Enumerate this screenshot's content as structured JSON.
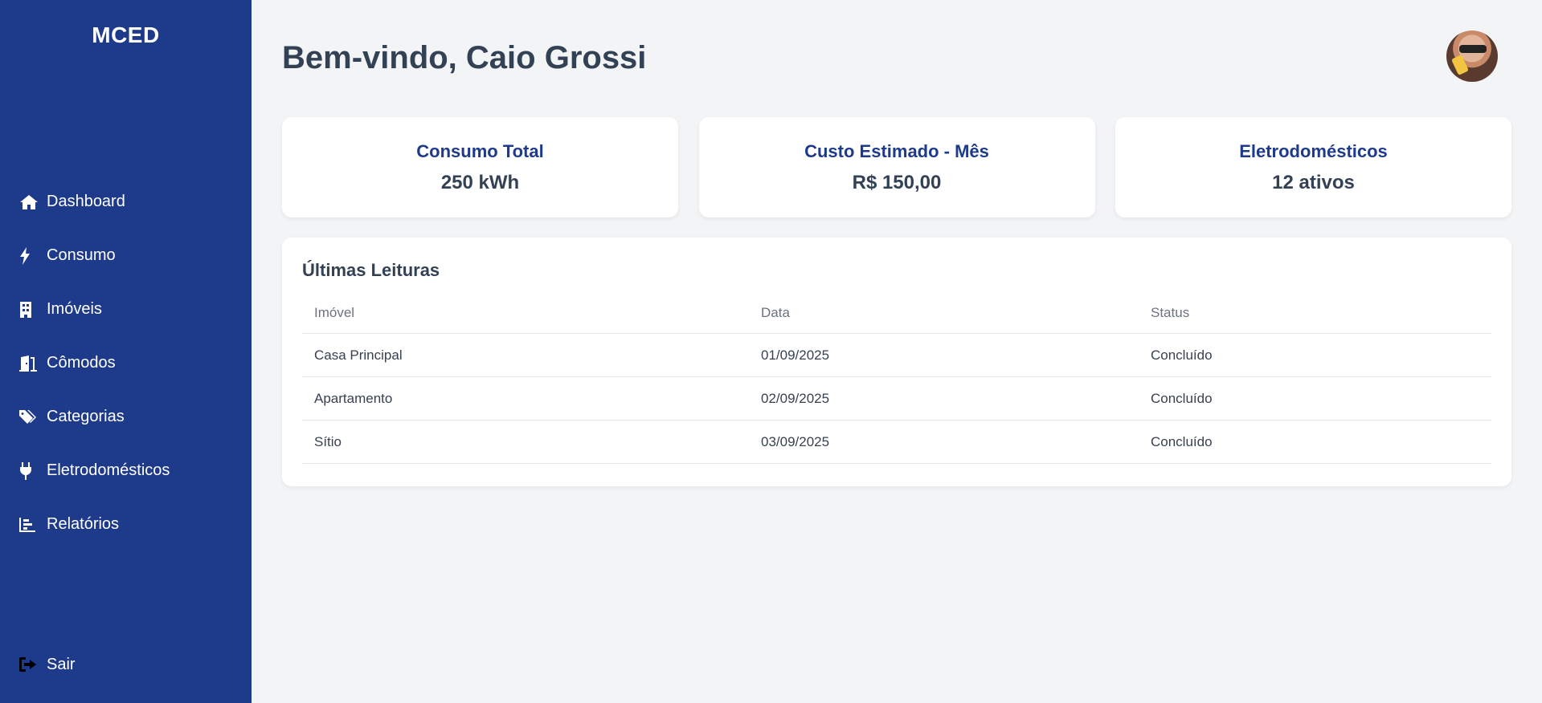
{
  "sidebar": {
    "brand": "MCED",
    "items": [
      {
        "label": "Dashboard",
        "icon": "home-icon"
      },
      {
        "label": "Consumo",
        "icon": "bolt-icon"
      },
      {
        "label": "Imóveis",
        "icon": "building-icon"
      },
      {
        "label": "Cômodos",
        "icon": "door-icon"
      },
      {
        "label": "Categorias",
        "icon": "tags-icon"
      },
      {
        "label": "Eletrodomésticos",
        "icon": "plug-icon"
      },
      {
        "label": "Relatórios",
        "icon": "chart-icon"
      }
    ],
    "logout": {
      "label": "Sair",
      "icon": "logout-icon"
    }
  },
  "header": {
    "title": "Bem-vindo, Caio Grossi"
  },
  "cards": [
    {
      "title": "Consumo Total",
      "value": "250 kWh"
    },
    {
      "title": "Custo Estimado - Mês",
      "value": "R$ 150,00"
    },
    {
      "title": "Eletrodomésticos",
      "value": "12 ativos"
    }
  ],
  "readings": {
    "title": "Últimas Leituras",
    "columns": [
      "Imóvel",
      "Data",
      "Status"
    ],
    "rows": [
      [
        "Casa Principal",
        "01/09/2025",
        "Concluído"
      ],
      [
        "Apartamento",
        "02/09/2025",
        "Concluído"
      ],
      [
        "Sítio",
        "03/09/2025",
        "Concluído"
      ]
    ]
  },
  "colors": {
    "sidebar": "#1e3a8a",
    "accent": "#1e3a8a",
    "background": "#f3f4f6"
  }
}
